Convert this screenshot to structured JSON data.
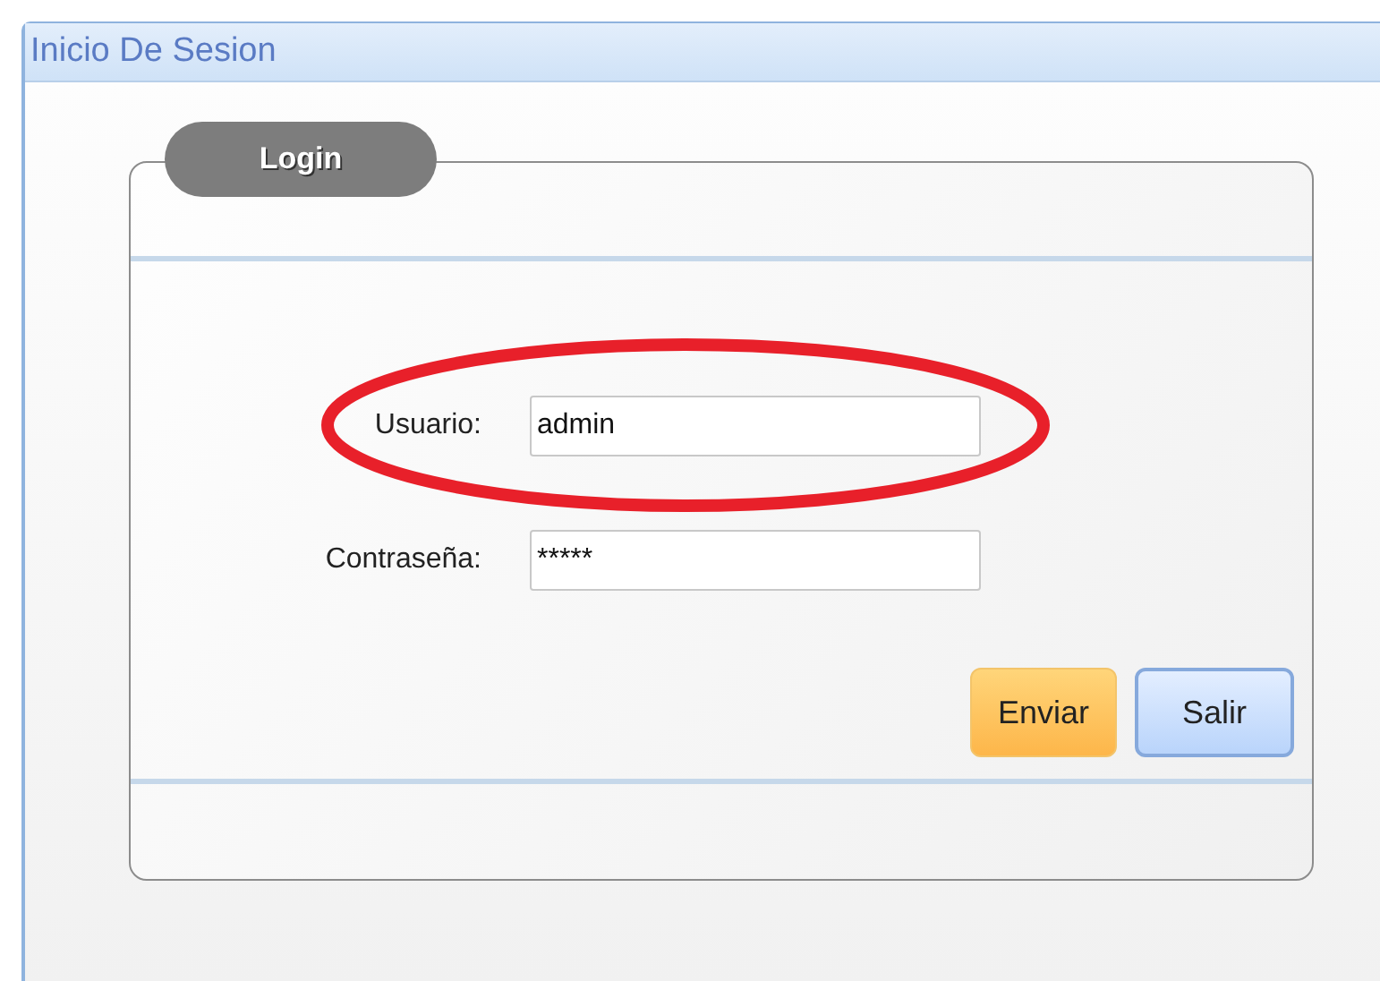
{
  "window": {
    "title": "Inicio De Sesion"
  },
  "group": {
    "title": "Login"
  },
  "fields": [
    {
      "label": "Usuario:",
      "value": "admin",
      "highlighted": true
    },
    {
      "label": "Contraseña:",
      "value": "*****",
      "highlighted": false
    }
  ],
  "buttons": [
    {
      "label": "Enviar",
      "kind": "default"
    },
    {
      "label": "Salir",
      "kind": "normal"
    }
  ]
}
